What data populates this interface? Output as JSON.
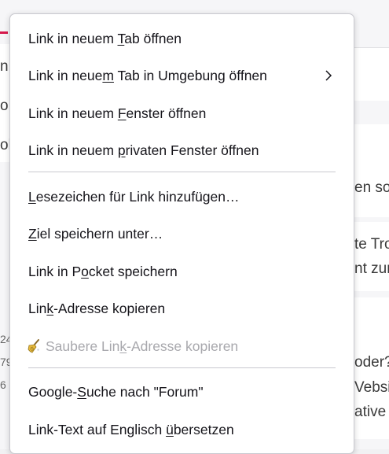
{
  "background": {
    "left_fragments": [
      "n",
      "o",
      "ol",
      "24",
      "79",
      "6"
    ],
    "right_fragments": [
      "en so",
      "te Tro",
      "nt zur",
      "oder?",
      "Vebsi",
      "ative"
    ]
  },
  "menu": {
    "items": [
      {
        "pre": "Link in neuem ",
        "u": "T",
        "post": "ab öffnen"
      },
      {
        "pre": "Link in neue",
        "u": "m",
        "post": " Tab in Umgebung öffnen"
      },
      {
        "pre": "Link in neuem ",
        "u": "F",
        "post": "enster öffnen"
      },
      {
        "pre": "Link in neuem ",
        "u": "p",
        "post": "rivaten Fenster öffnen"
      },
      {
        "pre": "",
        "u": "L",
        "post": "esezeichen für Link hinzufügen…"
      },
      {
        "pre": "",
        "u": "Z",
        "post": "iel speichern unter…"
      },
      {
        "pre": "Link in P",
        "u": "o",
        "post": "cket speichern"
      },
      {
        "pre": "Lin",
        "u": "k",
        "post": "-Adresse kopieren"
      },
      {
        "pre": "Saubere Lin",
        "u": "k",
        "post": "-Adresse kopieren"
      },
      {
        "pre": "Google-",
        "u": "S",
        "post": "uche nach \"Forum\""
      },
      {
        "pre": "Link-Text auf Englisch ",
        "u": "ü",
        "post": "bersetzen"
      }
    ]
  },
  "colors": {
    "accent": "#d7194c",
    "menu_text": "#15141a",
    "disabled_text": "#a8a8ad",
    "separator": "#c9c9cf"
  },
  "icons": {
    "submenu": "chevron-right-icon",
    "clean_link": "broom-icon"
  }
}
